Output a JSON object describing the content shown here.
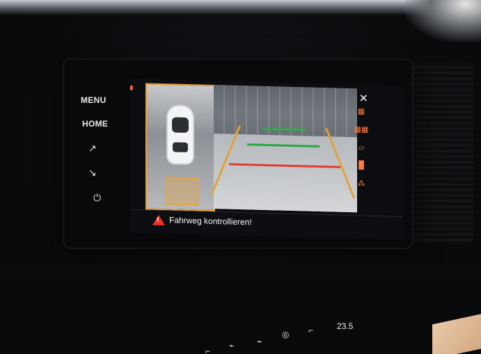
{
  "side_keys": {
    "menu": "MENU",
    "home": "HOME"
  },
  "side_icons": {
    "seat_recline_up": "↗",
    "seat_recline_down": "↘",
    "power": "⏻"
  },
  "display": {
    "close": "✕",
    "warning": "Fahrweg kontrollieren!",
    "left_panel_icons": [
      "Ⓐ▲",
      "◀▲"
    ],
    "right_panel_icons": [
      "▦",
      "▦▦",
      "▱",
      "▐▌",
      "⁂"
    ]
  },
  "console": {
    "temperature": "23.5"
  },
  "colors": {
    "warning_red": "#e5322b",
    "guide_green": "#27a83f",
    "guide_red": "#e23a2f",
    "guide_orange": "#e0a33b"
  }
}
